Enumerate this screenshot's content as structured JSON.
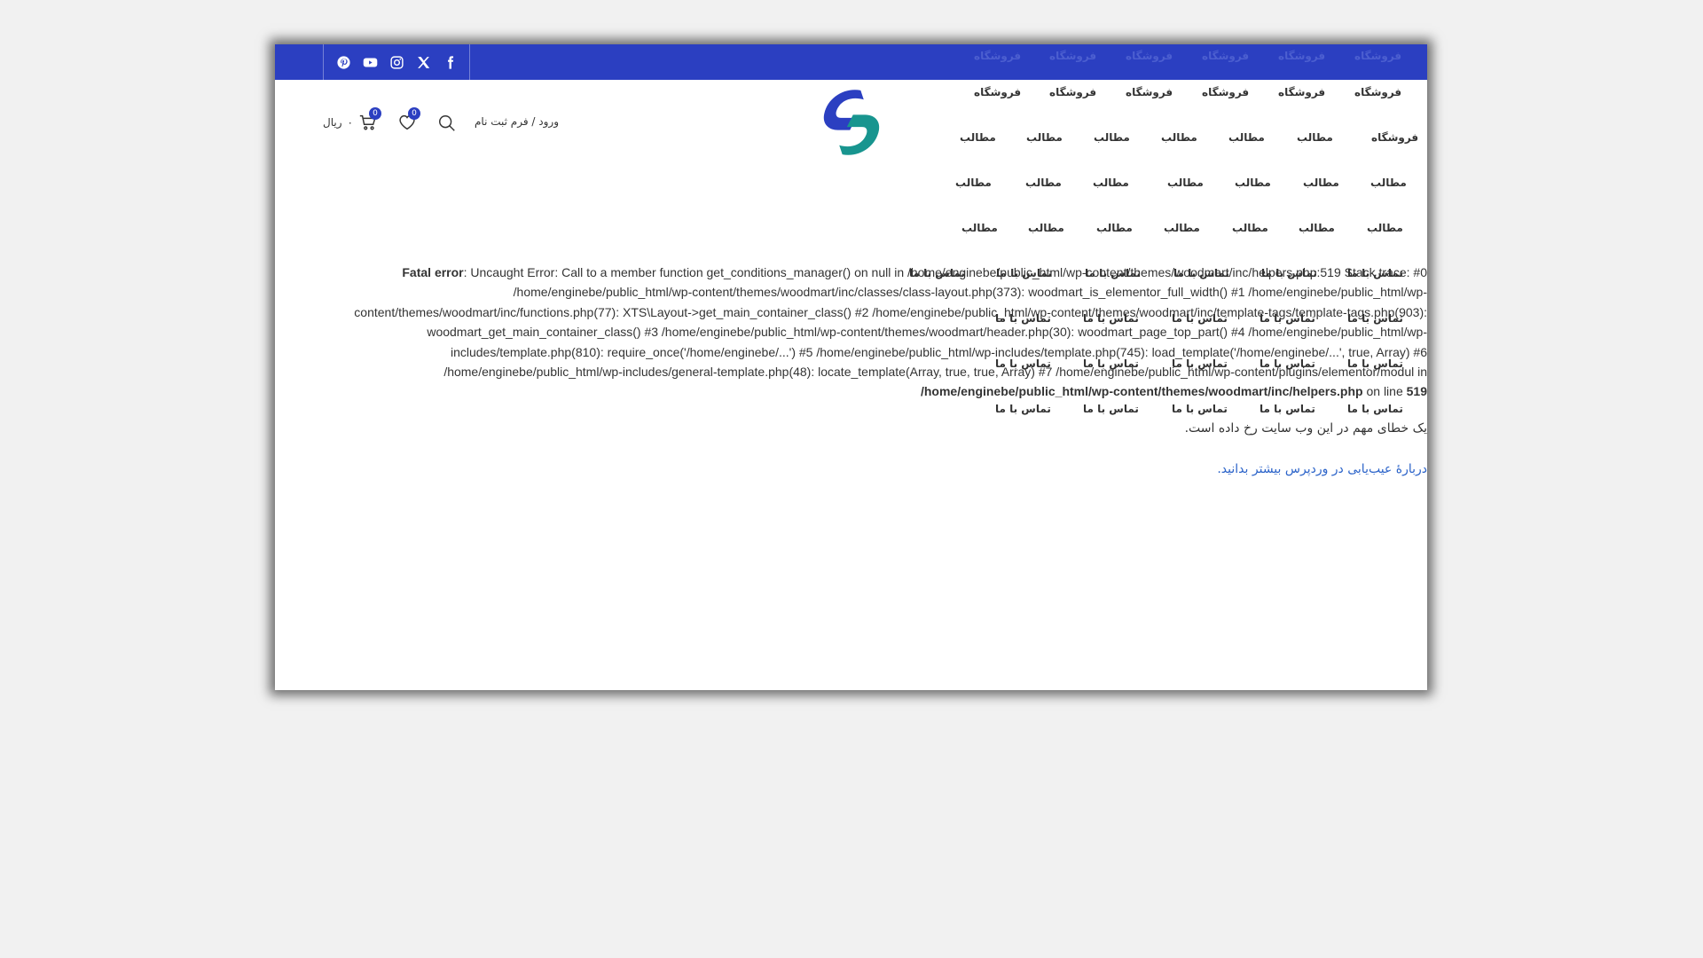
{
  "topbar": {
    "social": [
      {
        "name": "facebook-icon"
      },
      {
        "name": "x-icon"
      },
      {
        "name": "instagram-icon"
      },
      {
        "name": "youtube-icon"
      },
      {
        "name": "pinterest-icon"
      }
    ]
  },
  "header": {
    "cart_label": "ریال",
    "cart_amount": "۰",
    "cart_count": "0",
    "wishlist_count": "0",
    "login_label": "ورود / فرم ثبت نام"
  },
  "menu": {
    "shop": "فروشگاه",
    "posts": "مطالب",
    "contact": "تماس با ما"
  },
  "error": {
    "label": "Fatal error",
    "text": ": Uncaught Error: Call to a member function get_conditions_manager() on null in /home/enginebe/public_html/wp-content/themes/woodmart/inc/helpers.php:519 Stack trace: #0 /home/enginebe/public_html/wp-content/themes/woodmart/inc/classes/class-layout.php(373): woodmart_is_elementor_full_width() #1 /home/enginebe/public_html/wp-content/themes/woodmart/inc/functions.php(77): XTS\\Layout->get_main_container_class() #2 /home/enginebe/public_html/wp-content/themes/woodmart/inc/template-tags/template-tags.php(903): woodmart_get_main_container_class() #3 /home/enginebe/public_html/wp-content/themes/woodmart/header.php(30): woodmart_page_top_part() #4 /home/enginebe/public_html/wp-includes/template.php(810): require_once('/home/enginebe/...') #5 /home/enginebe/public_html/wp-includes/template.php(745): load_template('/home/enginebe/...', true, Array) #6 /home/enginebe/public_html/wp-includes/general-template.php(48): locate_template(Array, true, true, Array) #7 /home/enginebe/public_html/wp-content/plugins/elementor/modul in",
    "file": "/home/enginebe/public_html/wp-content/themes/woodmart/inc/helpers.php",
    "on_line": " on line ",
    "line": "519"
  },
  "critical_message": "یک خطای مهم در این وب سایت رخ داده است.",
  "learn_more_link": "دربارهٔ عیب‌یابی در وردپرس بیشتر بدانید."
}
